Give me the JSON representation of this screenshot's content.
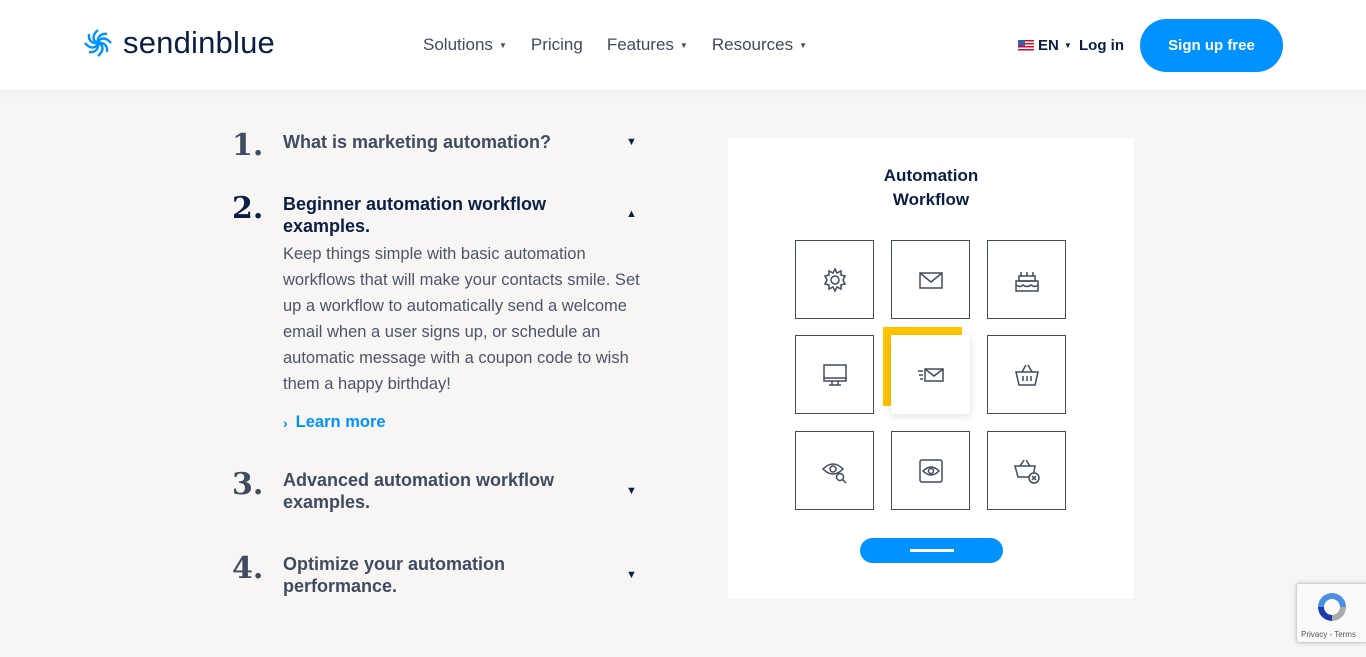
{
  "header": {
    "brand": "sendinblue",
    "nav": [
      {
        "label": "Solutions",
        "has_caret": true
      },
      {
        "label": "Pricing",
        "has_caret": false
      },
      {
        "label": "Features",
        "has_caret": true
      },
      {
        "label": "Resources",
        "has_caret": true
      }
    ],
    "language": "EN",
    "login_label": "Log in",
    "signup_label": "Sign up free"
  },
  "accordion": [
    {
      "number": "1.",
      "title": "What is marketing automation?",
      "expanded": false
    },
    {
      "number": "2.",
      "title": "Beginner automation workflow examples.",
      "expanded": true,
      "body": "Keep things simple with basic automation workflows that will make your contacts smile. Set up a workflow to automatically send a welcome email when a user signs up, or schedule an automatic message with a coupon code to wish them a happy birthday!",
      "link_label": "Learn more"
    },
    {
      "number": "3.",
      "title": "Advanced automation workflow examples.",
      "expanded": false
    },
    {
      "number": "4.",
      "title": "Optimize your automation performance.",
      "expanded": false
    }
  ],
  "illustration": {
    "title_line1": "Automation",
    "title_line2": "Workflow",
    "tiles": [
      "gear-icon",
      "envelope-icon",
      "cake-icon",
      "monitor-icon",
      "sending-envelope-icon",
      "basket-icon",
      "eye-search-icon",
      "eye-screen-icon",
      "basket-remove-icon"
    ]
  },
  "recaptcha": {
    "text": "Privacy - Terms"
  },
  "colors": {
    "accent": "#0092ff",
    "highlight": "#ffc500",
    "navy": "#0b1f44"
  }
}
